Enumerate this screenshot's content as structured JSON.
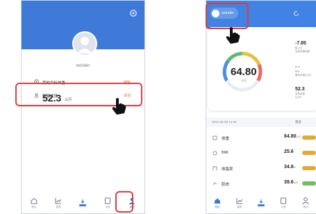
{
  "screen1": {
    "username": "wonder",
    "my_weight": {
      "label": "我的目标体重",
      "tag": "编辑",
      "value": "52.3",
      "unit": "公斤"
    },
    "family": {
      "label": "家庭成员",
      "tag": "添加"
    },
    "tabs": [
      {
        "label": "首页",
        "icon": "home-icon"
      },
      {
        "label": "趋势",
        "icon": "trend-icon"
      },
      {
        "label": "",
        "icon": "scale-icon"
      },
      {
        "label": "记录",
        "icon": "record-icon"
      },
      {
        "label": "我的",
        "icon": "profile-icon",
        "active": true
      }
    ]
  },
  "screen2": {
    "username": "wonder",
    "weight": {
      "value": "64.80",
      "unit": "公斤"
    },
    "stats": [
      {
        "value": "-7.85",
        "label": "距上次|目标体重相差"
      },
      {
        "value": "- -",
        "label": "BMI|最佳体重(公斤)"
      },
      {
        "value": "52.3",
        "label": "目标体重|(公斤)"
      }
    ],
    "date": "2022-05-09 14:48",
    "more": "更多",
    "metrics": [
      {
        "label": "体重",
        "value": "64.80",
        "unit": "公斤",
        "color": "#e5a92f"
      },
      {
        "label": "BMI",
        "value": "25.6",
        "unit": "",
        "color": "#e5a92f"
      },
      {
        "label": "体脂率",
        "value": "34.8",
        "unit": "%",
        "color": "#e5a92f"
      },
      {
        "label": "肌肉",
        "value": "39.6",
        "unit": "公斤",
        "color": "#6fbf5a"
      }
    ],
    "tabs": [
      "首页",
      "趋势",
      "",
      "记录",
      "我的"
    ]
  },
  "colors": {
    "primary": "#3f7ad8",
    "highlight": "#e03c3c"
  }
}
